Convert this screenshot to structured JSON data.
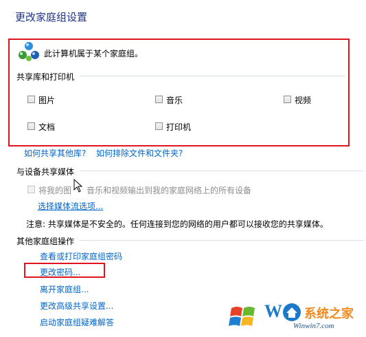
{
  "page": {
    "title": "更改家庭组设置"
  },
  "membership": {
    "text": "此计算机属于某个家庭组。"
  },
  "shared_libraries": {
    "heading": "共享库和打印机",
    "items": [
      {
        "label": "图片"
      },
      {
        "label": "音乐"
      },
      {
        "label": "视频"
      },
      {
        "label": "文档"
      },
      {
        "label": "打印机"
      }
    ]
  },
  "links_top": {
    "other_libraries": "如何共享其他库?",
    "exclude_files": "如何排除文件和文件夹?"
  },
  "media": {
    "heading": "与设备共享媒体",
    "checkbox_left": "将我的图",
    "checkbox_right": "音乐和视频输出到我的家庭网络上的所有设备",
    "options_link": "选择媒体流选项...",
    "note": "注意: 共享媒体是不安全的。任何连接到您的网络的用户都可以接收您的共享媒体。"
  },
  "other_actions": {
    "heading": "其他家庭组操作",
    "items": [
      {
        "label": "查看或打印家庭组密码"
      },
      {
        "label": "更改密码..."
      },
      {
        "label": "离开家庭组..."
      },
      {
        "label": "更改高级共享设置..."
      },
      {
        "label": "启动家庭组疑难解答"
      }
    ]
  },
  "watermark": {
    "brand_left": "W",
    "brand_right": "系统之家",
    "url": "Winwin7.com"
  },
  "colors": {
    "title_blue": "#1e3287",
    "link_blue": "#0066cc",
    "highlight_red": "#e0141e"
  }
}
